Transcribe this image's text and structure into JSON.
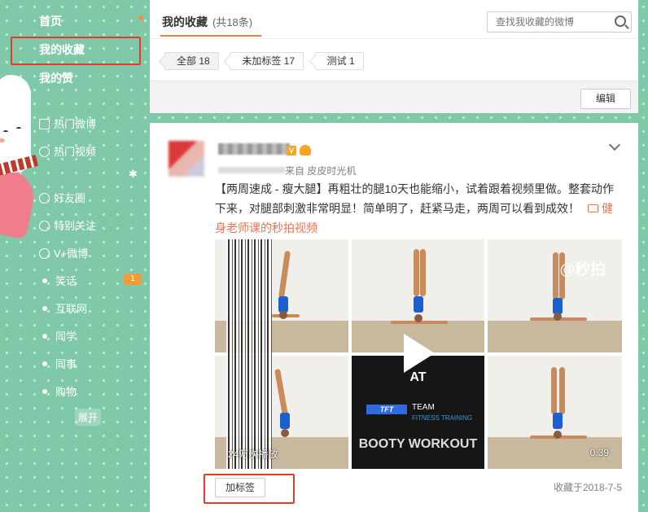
{
  "sidebar": {
    "home": "首页",
    "my_favorites": "我的收藏",
    "my_likes": "我的赞",
    "hot_weibo": "热门微博",
    "hot_video": "热门视频",
    "groups": [
      {
        "label": "好友圈",
        "icon": "friends-icon"
      },
      {
        "label": "特别关注",
        "icon": "special-follow-icon"
      },
      {
        "label": "V+微博",
        "icon": "vplus-icon"
      }
    ],
    "lists": [
      "笑话",
      "互联网",
      "同学",
      "同事",
      "购物"
    ],
    "joke_badge": "1",
    "expand": "展开",
    "accent_color": "#7fc9a8"
  },
  "header": {
    "tab_title": "我的收藏",
    "tab_count": "(共18条)",
    "search_placeholder": "查找我收藏的微博",
    "tags": [
      "全部 18",
      "未加标签 17",
      "测试 1"
    ],
    "edit_label": "编辑",
    "accent_color": "#fa7d3c"
  },
  "post": {
    "source": "来自 皮皮时光机",
    "text": "【两周速成 - 瘦大腿】再粗壮的腿10天也能缩小，试着跟着视频里做。整套动作下来，对腿部刺激非常明显！简单明了，赶紧马走，两周可以看到成效！",
    "link_text": "健身老师课的秒拍视频",
    "video": {
      "center_title": "AT",
      "logo_text": "TFT",
      "team_text": "TEAM",
      "fitness_text": "FITNESS TRAINING",
      "bottom_title": "BOOTY WORKOUT",
      "watermark": "@秒拍",
      "play_count": "24万次播放",
      "duration": "0:39"
    },
    "add_tag_label": "加标签",
    "favorited_date": "收藏于2018-7-5",
    "link_color": "#eb7350"
  }
}
